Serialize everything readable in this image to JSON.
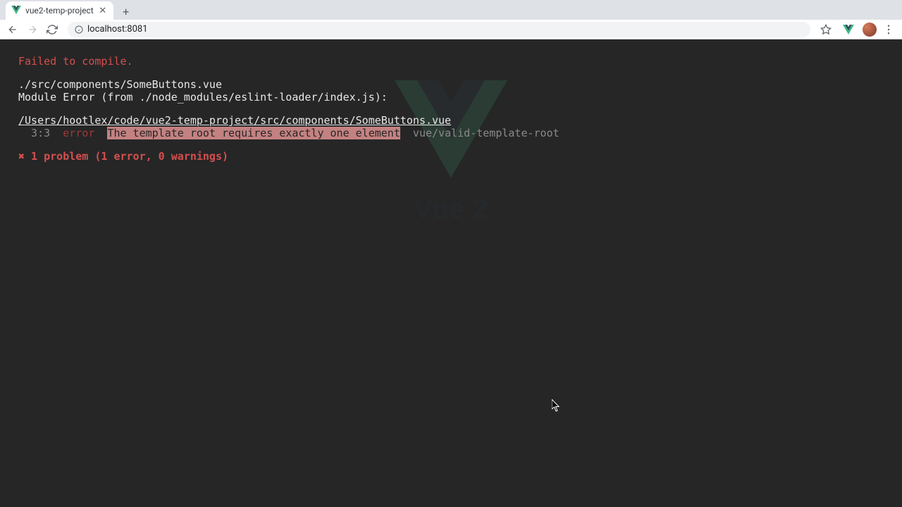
{
  "browser": {
    "tab_title": "vue2-temp-project",
    "url": "localhost:8081"
  },
  "bg": {
    "heading": "Vue 2"
  },
  "err": {
    "header": "Failed to compile.",
    "file_rel": "./src/components/SomeButtons.vue",
    "module_err": "Module Error (from ./node_modules/eslint-loader/index.js):",
    "file_abs": "/Users/hootlex/code/vue2-temp-project/src/components/SomeButtons.vue",
    "loc": "  3:3",
    "level": "error",
    "msg": "The template root requires exactly one element",
    "rule": "vue/valid-template-root",
    "summary": "✖ 1 problem (1 error, 0 warnings)"
  }
}
